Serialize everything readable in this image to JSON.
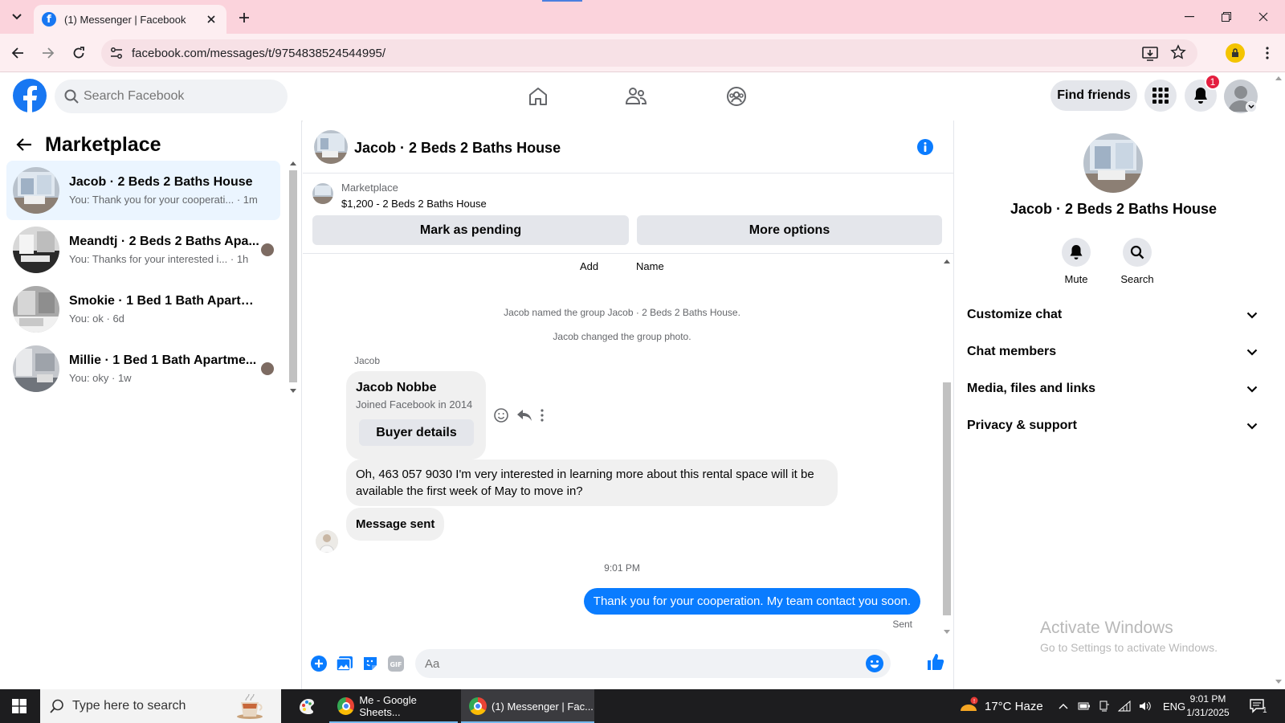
{
  "browser": {
    "tab_title": "(1) Messenger | Facebook",
    "url": "facebook.com/messages/t/9754838524544995/"
  },
  "fb": {
    "search_placeholder": "Search Facebook",
    "find_friends": "Find friends",
    "notification_count": "1"
  },
  "left": {
    "title": "Marketplace",
    "conversations": [
      {
        "name": "Jacob · 2 Beds 2 Baths House",
        "preview": "You: Thank you for your cooperati... · 1m"
      },
      {
        "name": "Meandtj · 2 Beds 2 Baths Apa...",
        "preview": "You: Thanks for your interested i... · 1h"
      },
      {
        "name": "Smokie · 1 Bed 1 Bath Apartmen...",
        "preview": "You: ok · 6d"
      },
      {
        "name": "Millie · 1 Bed 1 Bath Apartme...",
        "preview": "You: oky · 1w"
      }
    ]
  },
  "chat": {
    "title": "Jacob · 2 Beds 2 Baths House",
    "marketplace_label": "Marketplace",
    "listing": "$1,200 - 2 Beds 2 Baths House",
    "mark_pending": "Mark as pending",
    "more_options": "More options",
    "add_label": "Add",
    "name_label": "Name",
    "system_messages": [
      "Jacob named the group Jacob · 2 Beds 2 Baths House.",
      "Jacob changed the group photo."
    ],
    "sender": "Jacob",
    "card_name": "Jacob Nobbe",
    "card_sub": "Joined Facebook in 2014",
    "card_button": "Buyer details",
    "incoming_message": "Oh, 463 057 9030 I'm very interested in learning more about this rental space will it be available the first week of May to move in?",
    "message_sent": "Message sent",
    "timestamp": "9:01 PM",
    "outgoing_message": "Thank you for your cooperation. My team contact you soon.",
    "sent_status": "Sent",
    "composer_placeholder": "Aa"
  },
  "right": {
    "name": "Jacob · 2 Beds 2 Baths House",
    "mute": "Mute",
    "search": "Search",
    "sections": [
      "Customize chat",
      "Chat members",
      "Media, files and links",
      "Privacy & support"
    ]
  },
  "watermark": {
    "line1": "Activate Windows",
    "line2": "Go to Settings to activate Windows."
  },
  "taskbar": {
    "search_placeholder": "Type here to search",
    "items": [
      "Me - Google Sheets...",
      "(1) Messenger | Fac..."
    ],
    "weather": "17°C Haze",
    "language": "ENG",
    "time": "9:01 PM",
    "date": "1/31/2025",
    "notif_count": "1"
  },
  "colors": {
    "fb_blue": "#1877f2",
    "messenger_blue": "#0a7cff",
    "tabbar_pink": "#fbd3dc"
  }
}
